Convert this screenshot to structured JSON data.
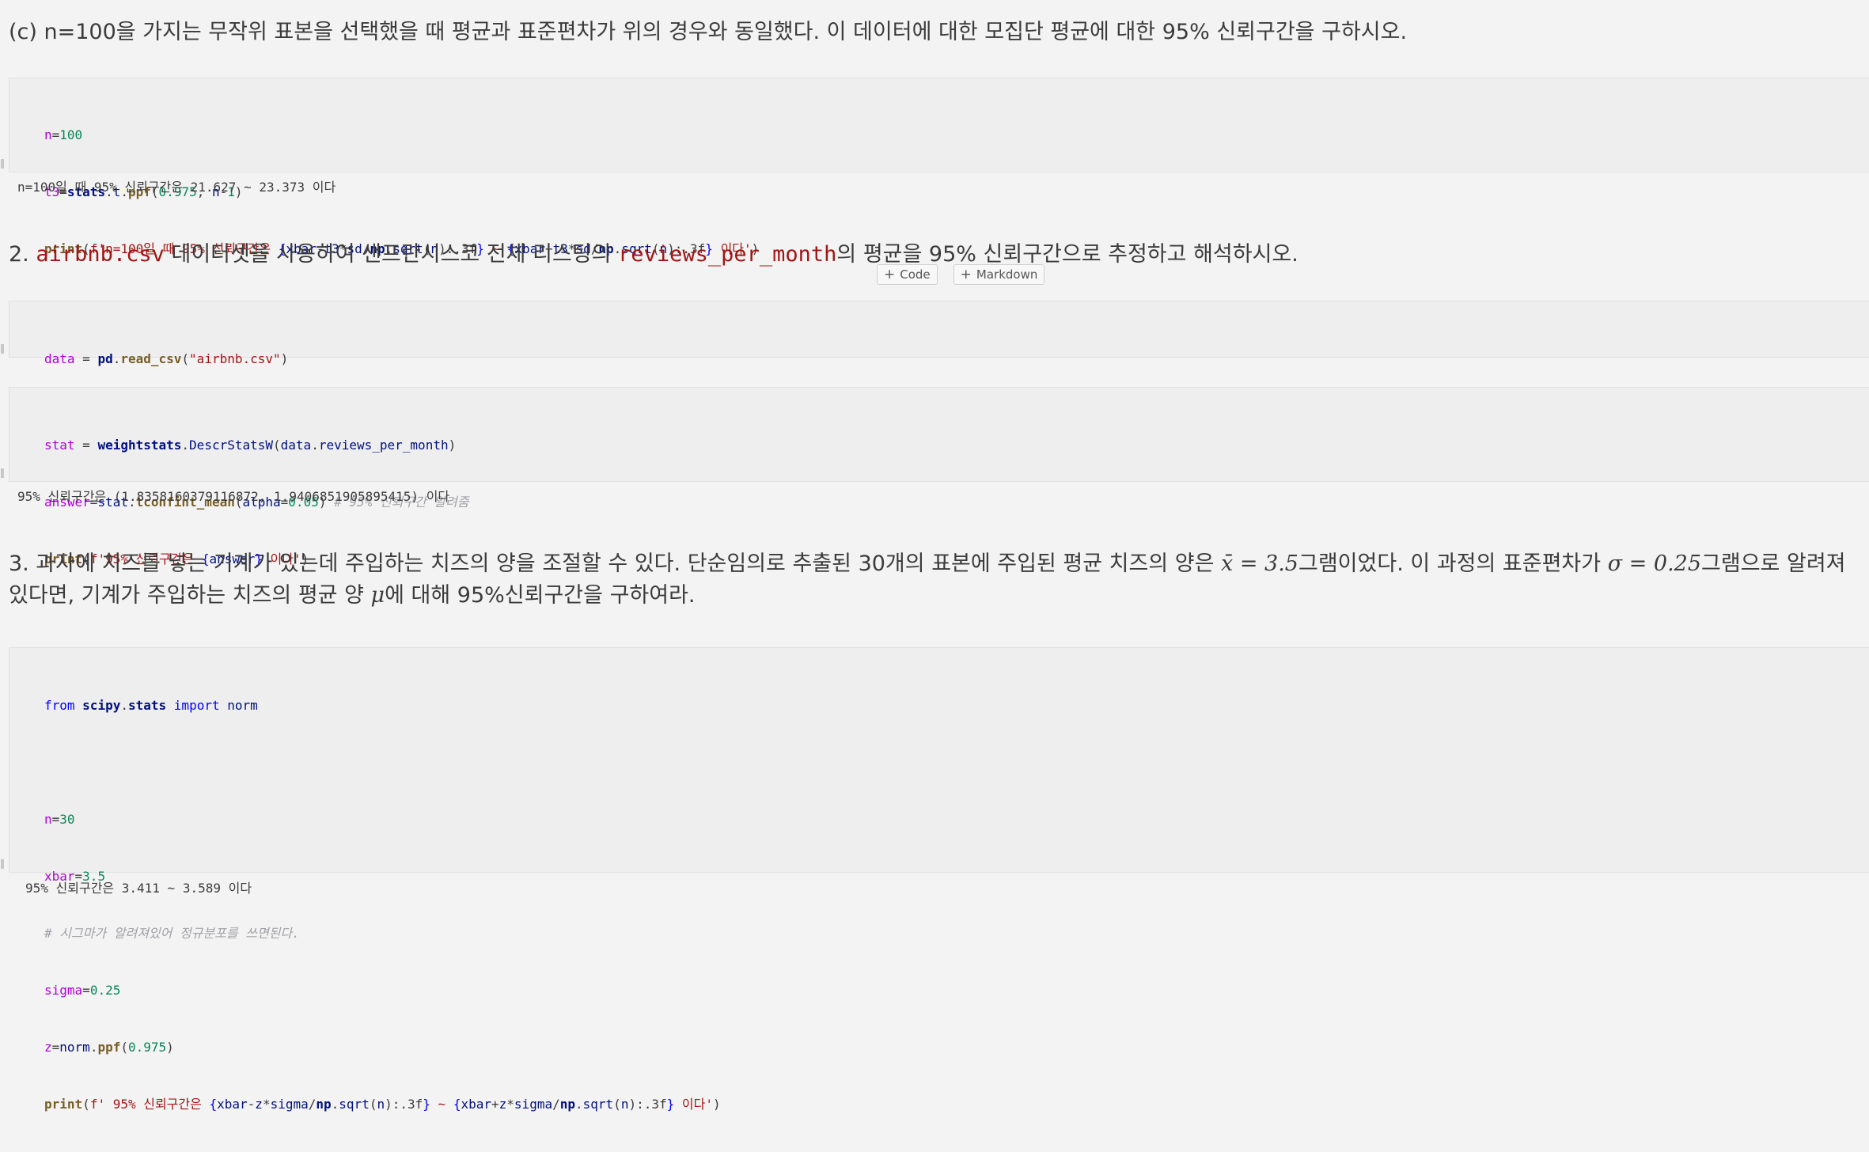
{
  "q1c": {
    "text": "(c) n=100을 가지는 무작위 표본을 선택했을 때 평균과 표준편차가 위의 경우와 동일했다. 이 데이터에 대한 모집단 평균에 대한 95% 신뢰구간을 구하시오."
  },
  "cell1": {
    "lines": [
      "n=100",
      "t3=stats.t.ppf(0.975, n-1)",
      "print(f'n=100일 때 95% 신뢰구간은 {xbar-t3*sd/np.sqrt(n):.3f} ~ {xbar+t3*sd/np.sqrt(n):.3f} 이다')"
    ],
    "output": "n=100일 때 95% 신뢰구간은 21.627 ~ 23.373 이다"
  },
  "q2": {
    "prefix": "2. ",
    "code1": "airbnb.csv",
    "mid": " 데이터셋을 사용하여 샌프란시스코 전체 리스팅의 ",
    "code2": "reviews_per_month",
    "suffix": "의 평균을 95% 신뢰구간으로 추정하고 해석하시오."
  },
  "toolbar": {
    "code_label": "Code",
    "markdown_label": "Markdown"
  },
  "cell2": {
    "lines": [
      "data = pd.read_csv(\"airbnb.csv\")"
    ]
  },
  "cell3": {
    "lines": [
      "stat = weightstats.DescrStatsW(data.reviews_per_month)",
      "answer=stat.tconfint_mean(alpha=0.05) # 95% 신뢰구간 알려줌",
      "print(f'95% 신뢰구간은 {answer} 이다')"
    ],
    "output": "95% 신뢰구간은 (1.8358160379116872, 1.9406851905895415) 이다"
  },
  "q3": {
    "part1": "3. 과자에 치즈를 넣는 기계가 있는데 주입하는 치즈의 양을 조절할 수 있다. 단순임의로 추출된 30개의 표본에 주입된 평균 치즈의 양은 ",
    "math1": "x̄ = 3.5",
    "part2": "그램이었다. 이 과정의 표준편차가 ",
    "math2": "σ = 0.25",
    "part3": "그램으로 알려져 있다면, 기계가 주입하는 치즈의 평균 양 ",
    "math3": "μ",
    "part4": "에 대해 95%신뢰구간을 구하여라."
  },
  "cell4": {
    "lines": [
      "from scipy.stats import norm",
      "",
      "n=30",
      "xbar=3.5",
      "# 시그마가 알려져있어 정규분포를 쓰면된다.",
      "sigma=0.25",
      "z=norm.ppf(0.975)",
      "print(f' 95% 신뢰구간은 {xbar-z*sigma/np.sqrt(n):.3f} ~ {xbar+z*sigma/np.sqrt(n):.3f} 이다')"
    ],
    "output": "95% 신뢰구간은 3.411 ~ 3.589 이다"
  }
}
